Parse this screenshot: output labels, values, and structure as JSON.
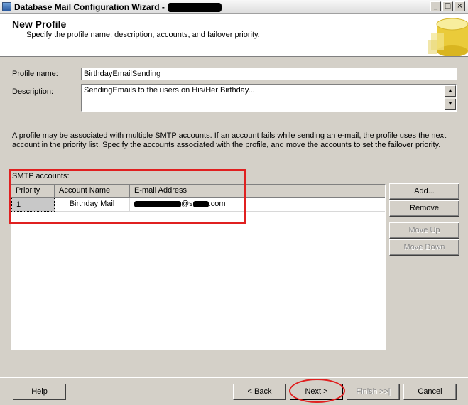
{
  "window": {
    "title": "Database Mail Configuration Wizard - "
  },
  "window_controls": {
    "minimize": "_",
    "maximize": "□",
    "close": "×"
  },
  "header": {
    "title": "New Profile",
    "subtitle": "Specify the profile name, description, accounts, and failover priority."
  },
  "form": {
    "profile_name_label": "Profile name:",
    "profile_name_value": "BirthdayEmailSending",
    "description_label": "Description:",
    "description_value": "SendingEmails to the users on His/Her Birthday..."
  },
  "info_text": "A profile may be associated with multiple SMTP accounts. If an account fails while sending an e-mail, the profile uses the next account in the priority list. Specify the accounts associated with the profile, and move the accounts to set the failover priority.",
  "smtp": {
    "label": "SMTP accounts:",
    "columns": [
      "Priority",
      "Account Name",
      "E-mail Address"
    ],
    "rows": [
      {
        "priority": "1",
        "account_name": "Birthday Mail",
        "email_visible_1": "@s",
        "email_visible_2": ".com"
      }
    ]
  },
  "side_buttons": {
    "add": "Add...",
    "remove": "Remove",
    "move_up": "Move Up",
    "move_down": "Move Down"
  },
  "footer": {
    "help": "Help",
    "back": "< Back",
    "next": "Next >",
    "finish": "Finish >>|",
    "cancel": "Cancel"
  },
  "colors": {
    "highlight": "#e02020",
    "face": "#d4d0c8"
  }
}
